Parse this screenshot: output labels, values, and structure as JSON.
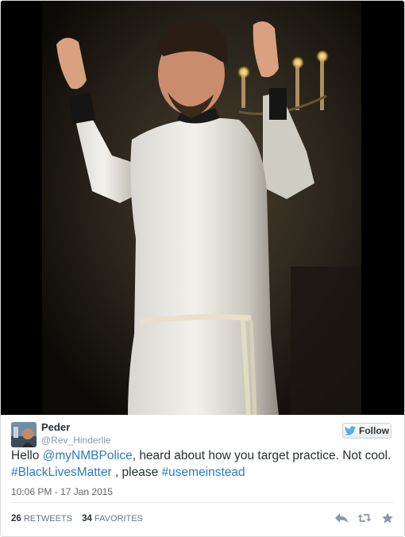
{
  "tweet": {
    "author": {
      "name": "Peder",
      "screen_name": "@Rev_Hinderlie"
    },
    "follow_label": "Follow",
    "text": {
      "seg1": "Hello ",
      "mention": "@myNMBPolice",
      "seg2": ", heard about how you target practice. Not cool. ",
      "hashtag1": "#BlackLivesMatter",
      "seg3": " , please ",
      "hashtag2": "#usemeinstead"
    },
    "timestamp": "10:06 PM - 17 Jan 2015",
    "stats": {
      "retweets_count": "26",
      "retweets_label": "RETWEETS",
      "favorites_count": "34",
      "favorites_label": "FAVORITES"
    }
  },
  "colors": {
    "link": "#2b7bb9",
    "text": "#292f33",
    "muted": "#8899a6",
    "twitter_blue": "#55acee"
  },
  "icons": {
    "follow": "twitter-bird-icon",
    "reply": "reply-icon",
    "retweet": "retweet-icon",
    "favorite": "star-icon"
  }
}
